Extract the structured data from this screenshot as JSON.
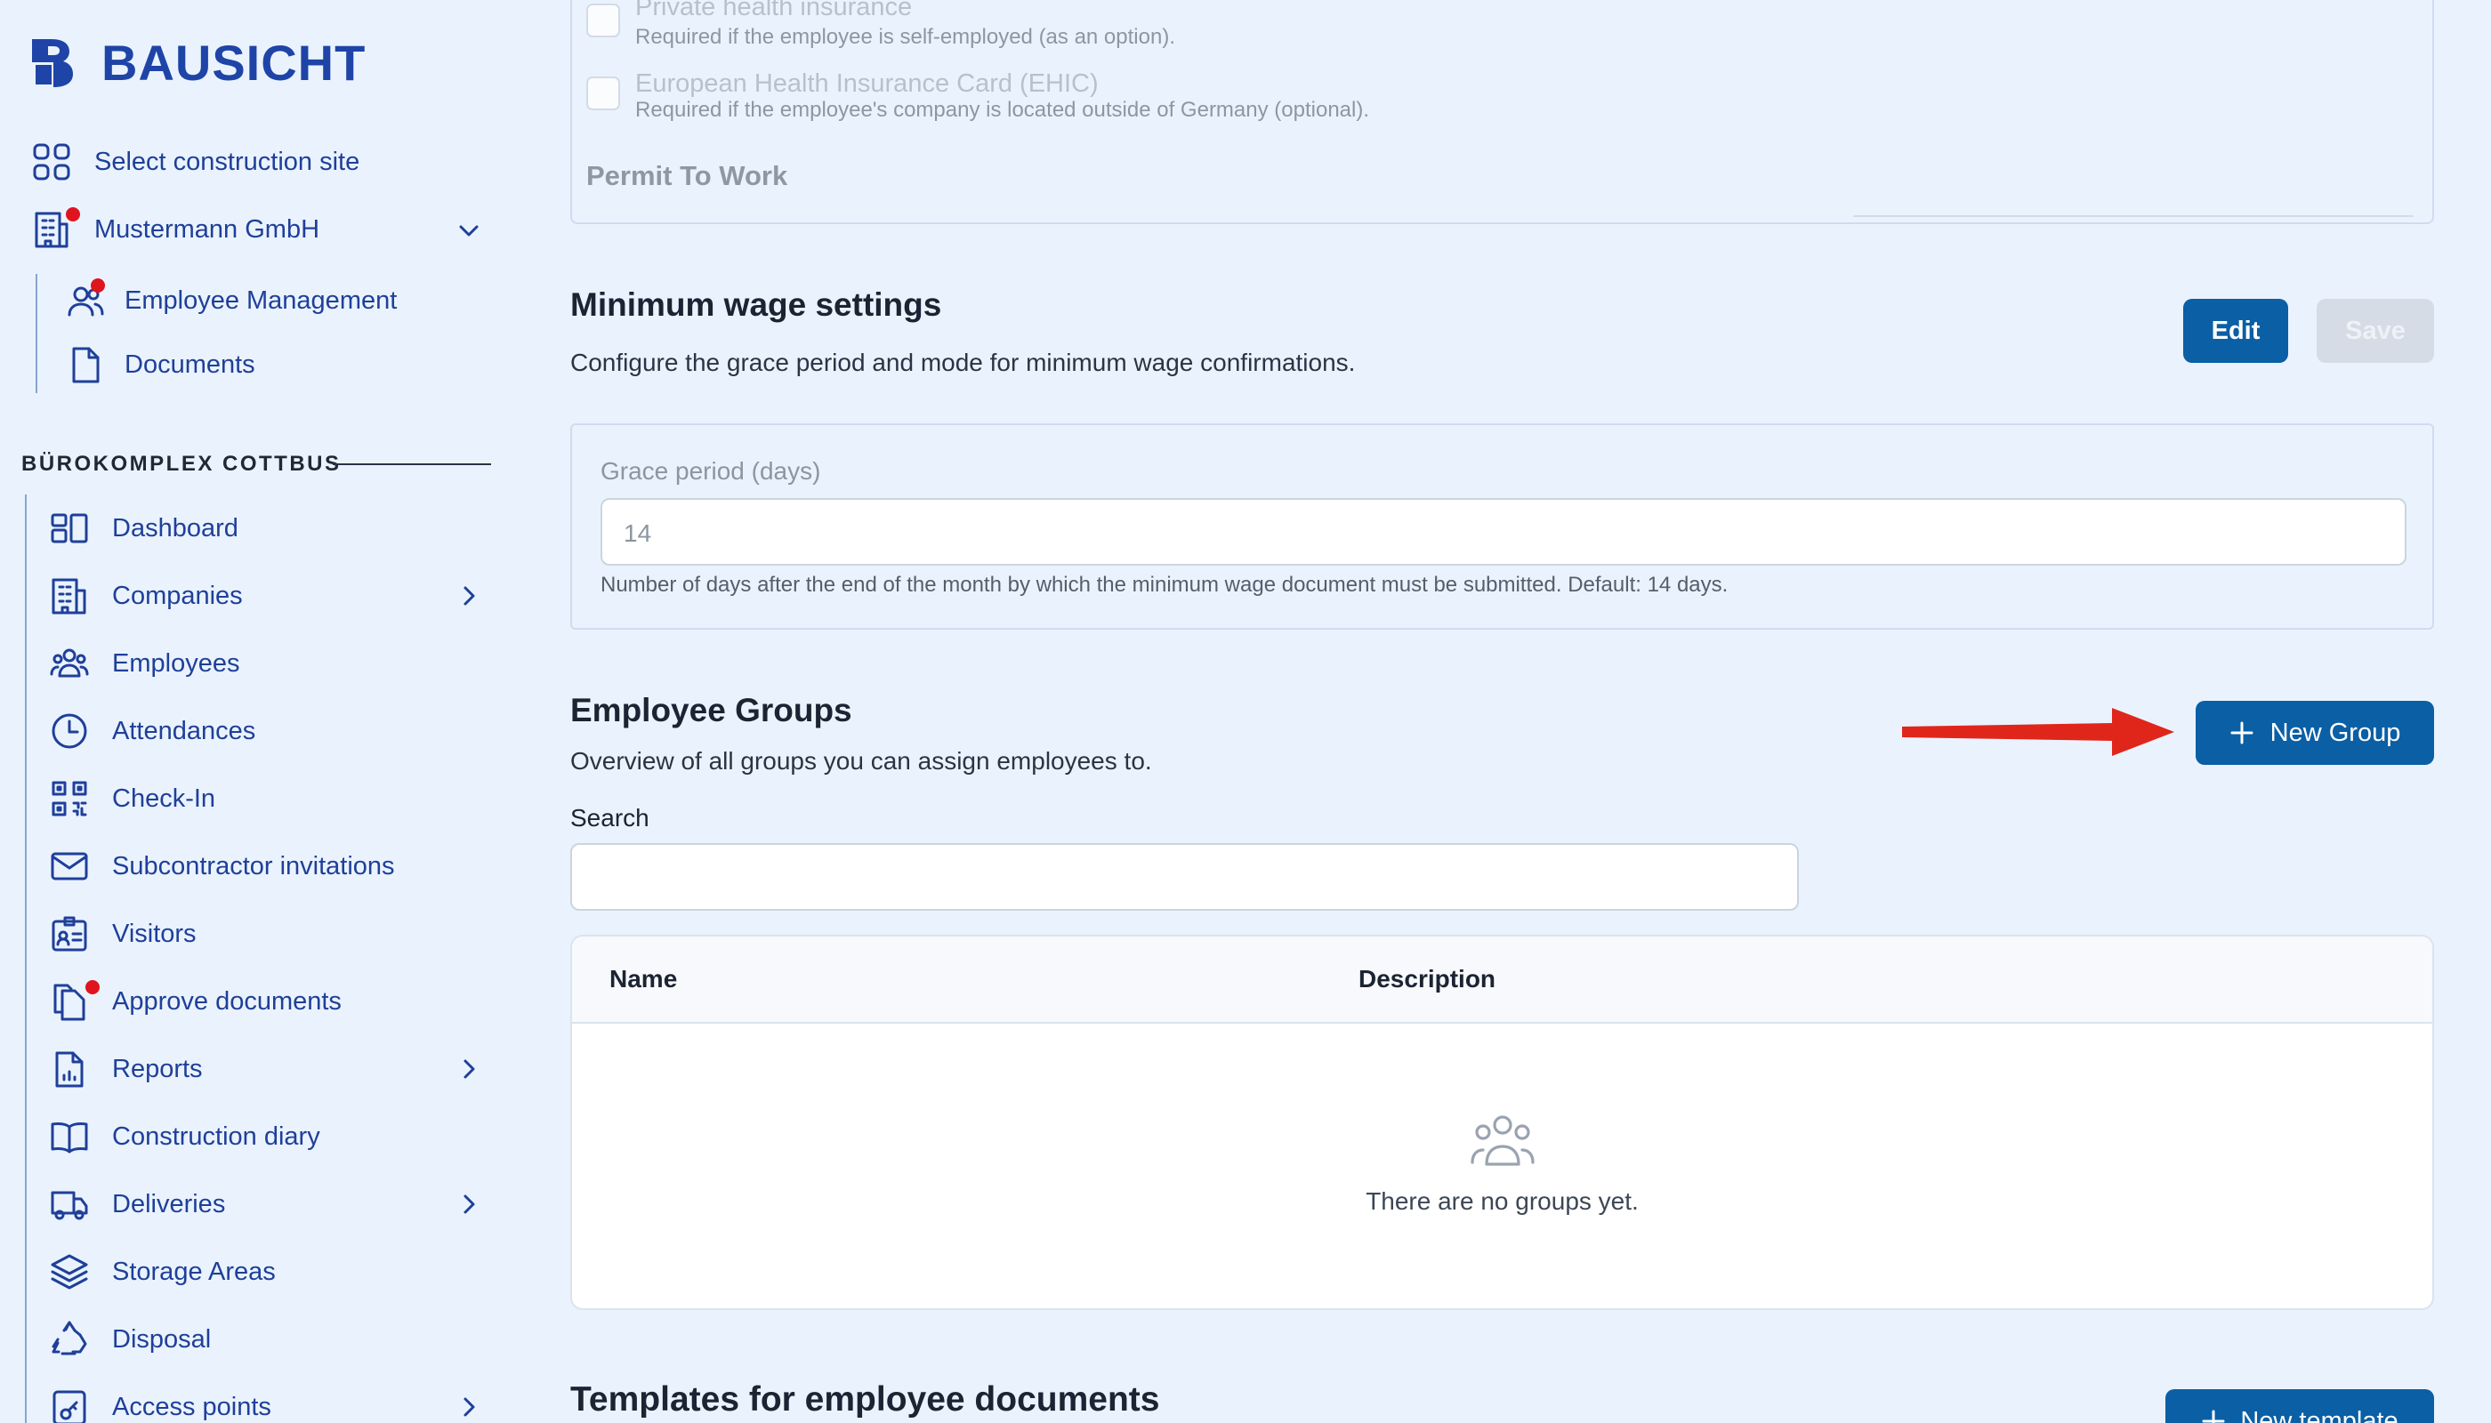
{
  "brand": {
    "name": "BAUSICHT",
    "color": "#1f44a8"
  },
  "sidebar": {
    "top_items": [
      {
        "label": "Select construction site",
        "icon": "grid-icon"
      },
      {
        "label": "Mustermann GmbH",
        "icon": "building-icon",
        "badge": true
      },
      {
        "label": "Employee Management",
        "icon": "users-icon",
        "badge": true
      },
      {
        "label": "Documents",
        "icon": "document-icon"
      }
    ],
    "section_title": "BÜROKOMPLEX COTTBUS",
    "items": [
      {
        "label": "Dashboard",
        "icon": "dashboard-icon"
      },
      {
        "label": "Companies",
        "icon": "building-icon",
        "has_children": true
      },
      {
        "label": "Employees",
        "icon": "users-icon"
      },
      {
        "label": "Attendances",
        "icon": "clock-icon"
      },
      {
        "label": "Check-In",
        "icon": "qr-code-icon"
      },
      {
        "label": "Subcontractor invitations",
        "icon": "envelope-icon"
      },
      {
        "label": "Visitors",
        "icon": "id-badge-icon"
      },
      {
        "label": "Approve documents",
        "icon": "documents-icon",
        "badge": true
      },
      {
        "label": "Reports",
        "icon": "report-icon",
        "has_children": true
      },
      {
        "label": "Construction diary",
        "icon": "book-icon"
      },
      {
        "label": "Deliveries",
        "icon": "truck-icon",
        "has_children": true
      },
      {
        "label": "Storage Areas",
        "icon": "layers-icon"
      },
      {
        "label": "Disposal",
        "icon": "recycle-icon"
      },
      {
        "label": "Access points",
        "icon": "key-icon",
        "has_children": true
      }
    ]
  },
  "documents_card": {
    "items": [
      {
        "title": "Private health insurance",
        "subtitle": "Required if the employee is self-employed (as an option)."
      },
      {
        "title": "European Health Insurance Card (EHIC)",
        "subtitle": "Required if the employee's company is located outside of Germany (optional)."
      }
    ],
    "section_heading": "Permit To Work"
  },
  "minimum_wage": {
    "title": "Minimum wage settings",
    "description": "Configure the grace period and mode for minimum wage confirmations.",
    "edit_label": "Edit",
    "save_label": "Save",
    "grace_label": "Grace period (days)",
    "grace_value": "14",
    "grace_help": "Number of days after the end of the month by which the minimum wage document must be submitted. Default: 14 days."
  },
  "employee_groups": {
    "title": "Employee Groups",
    "description": "Overview of all groups you can assign employees to.",
    "new_group_label": "New Group",
    "search_label": "Search",
    "search_value": "",
    "columns": [
      "Name",
      "Description"
    ],
    "empty_text": "There are no groups yet."
  },
  "templates": {
    "title": "Templates for employee documents",
    "new_template_label": "New template"
  },
  "colors": {
    "primary": "#0a5fa5",
    "badge": "#e0141e",
    "arrow": "#e0261a"
  }
}
